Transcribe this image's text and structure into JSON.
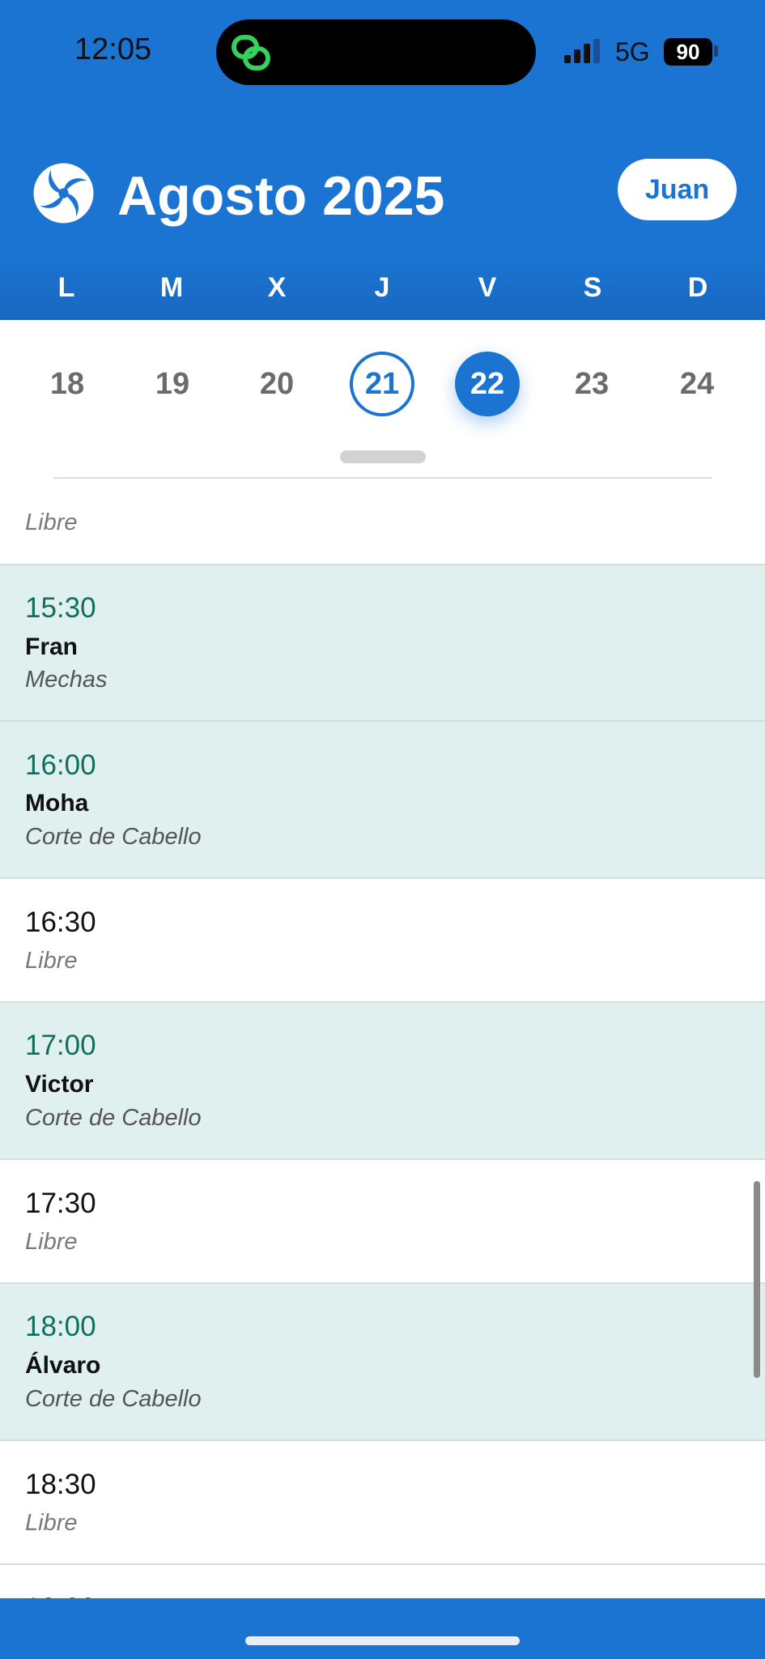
{
  "status_bar": {
    "time": "12:05",
    "network": "5G",
    "battery": "90"
  },
  "header": {
    "title": "Agosto 2025",
    "user_button": "Juan",
    "brand_color": "#1b74d1"
  },
  "week": {
    "weekdays": [
      "L",
      "M",
      "X",
      "J",
      "V",
      "S",
      "D"
    ],
    "days": [
      "18",
      "19",
      "20",
      "21",
      "22",
      "23",
      "24"
    ],
    "today": "21",
    "selected": "22"
  },
  "slots": [
    {
      "time": "",
      "client": "",
      "service": "Libre",
      "status": "free"
    },
    {
      "time": "15:30",
      "client": "Fran",
      "service": "Mechas",
      "status": "booked"
    },
    {
      "time": "16:00",
      "client": "Moha",
      "service": "Corte de Cabello",
      "status": "booked"
    },
    {
      "time": "16:30",
      "client": "",
      "service": "Libre",
      "status": "free"
    },
    {
      "time": "17:00",
      "client": "Victor",
      "service": "Corte de Cabello",
      "status": "booked"
    },
    {
      "time": "17:30",
      "client": "",
      "service": "Libre",
      "status": "free"
    },
    {
      "time": "18:00",
      "client": "Álvaro",
      "service": "Corte de Cabello",
      "status": "booked"
    },
    {
      "time": "18:30",
      "client": "",
      "service": "Libre",
      "status": "free"
    },
    {
      "time": "19:00",
      "client": "",
      "service": "",
      "status": "free"
    }
  ]
}
